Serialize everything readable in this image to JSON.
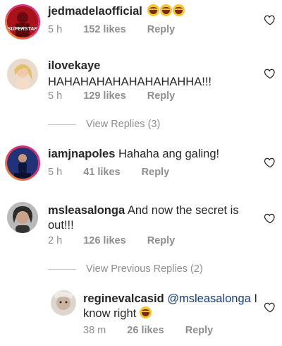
{
  "comments": [
    {
      "username": "jedmadelaofficial",
      "text": "",
      "emoji_count": 3,
      "time": "5 h",
      "likes": "152 likes",
      "reply": "Reply",
      "avatar_caption": "SUPERSTAR",
      "avatar_color": "#8b0f14"
    },
    {
      "username": "ilovekaye",
      "text": "HAHAHAHAHAHAHAHAHHA!!!",
      "time": "5 h",
      "likes": "129 likes",
      "reply": "Reply",
      "view_replies": "View Replies (3)",
      "avatar_color": "#e8d6c5"
    },
    {
      "username": "iamjnapoles",
      "text": "Hahaha ang galing!",
      "time": "5 h",
      "likes": "41 likes",
      "reply": "Reply",
      "avatar_color": "#1d2b6b"
    },
    {
      "username": "msleasalonga",
      "text_line1": "And now the secret is",
      "text_line2": "out!!!",
      "time": "2 h",
      "likes": "126 likes",
      "reply": "Reply",
      "view_previous": "View Previous Replies (2)",
      "avatar_color": "#9c9c9c"
    }
  ],
  "reply": {
    "username": "reginevalcasid",
    "mention": "@msleasalonga",
    "text_after_mention": " I",
    "text_line2": "know right",
    "time": "38 m",
    "likes": "26 likes",
    "reply": "Reply",
    "avatar_color": "#d9d3cc"
  },
  "colors": {
    "text": "#262626",
    "muted": "#8e8e8e",
    "mention": "#0f3c8a",
    "story_ring": "#e1306c"
  },
  "icons": [
    "heart-outline-icon",
    "laughing-emoji-icon"
  ]
}
